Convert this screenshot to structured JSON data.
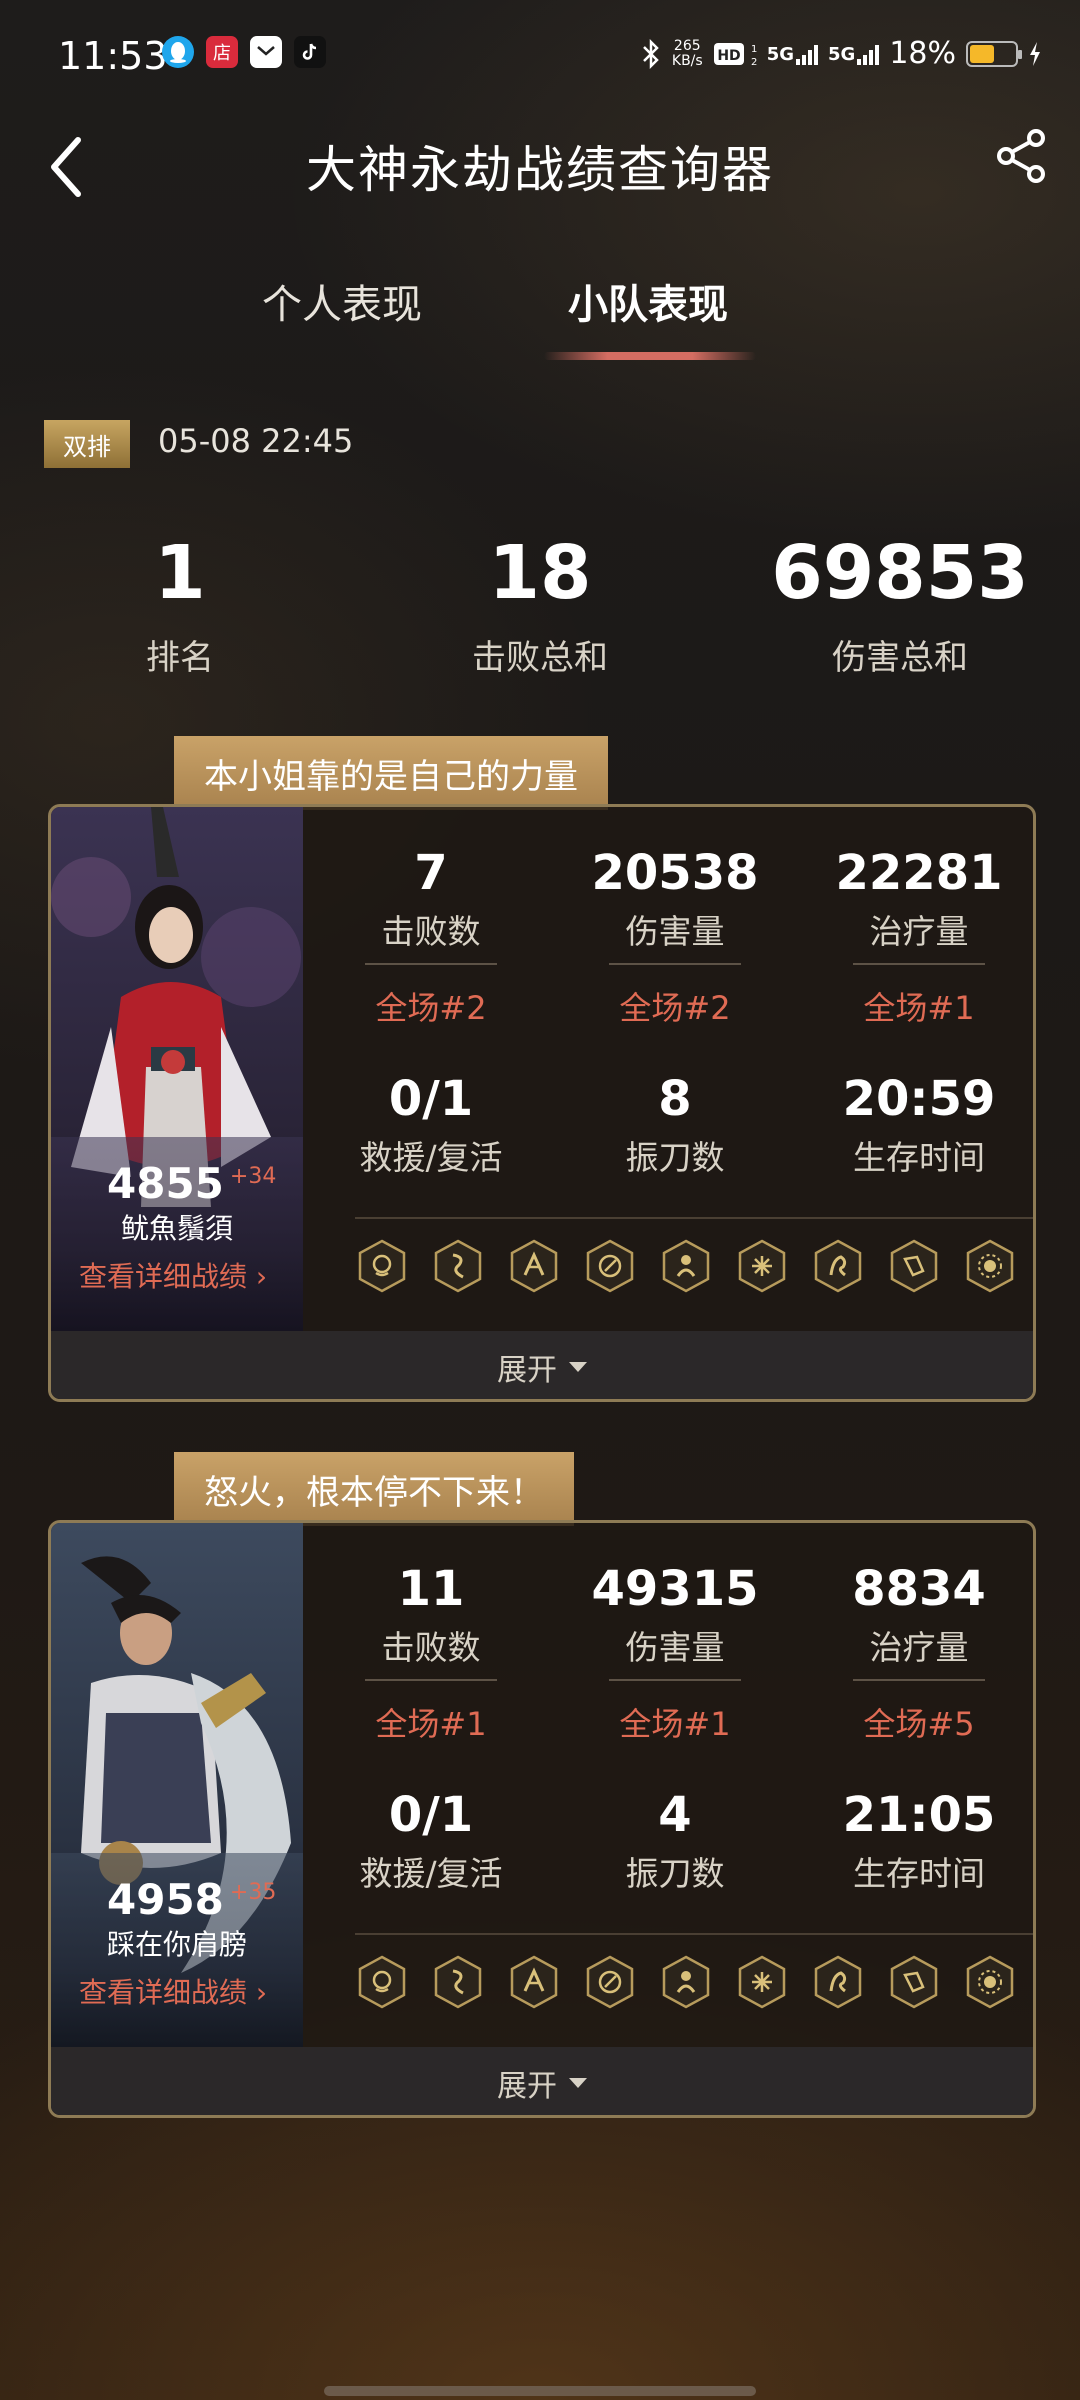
{
  "status_bar": {
    "time": "11:53",
    "net_speed_value": "265",
    "net_speed_unit": "KB/s",
    "network1": "5G",
    "network2": "5G",
    "battery_text": "18%"
  },
  "header": {
    "title": "大神永劫战绩查询器"
  },
  "tabs": {
    "personal": "个人表现",
    "squad": "小队表现"
  },
  "match": {
    "mode": "双排",
    "time": "05-08 22:45"
  },
  "summary": [
    {
      "value": "1",
      "label": "排名"
    },
    {
      "value": "18",
      "label": "击败总和"
    },
    {
      "value": "69853",
      "label": "伤害总和"
    }
  ],
  "players": [
    {
      "quote": "本小姐靠的是自己的力量",
      "score": "4855",
      "score_delta": "+34",
      "name": "鱿魚鬚須",
      "detail_link": "查看详细战绩 ›",
      "stats": [
        {
          "value": "7",
          "label": "击败数",
          "rank": "全场#2"
        },
        {
          "value": "20538",
          "label": "伤害量",
          "rank": "全场#2"
        },
        {
          "value": "22281",
          "label": "治疗量",
          "rank": "全场#1"
        },
        {
          "value": "0/1",
          "label": "救援/复活"
        },
        {
          "value": "8",
          "label": "振刀数"
        },
        {
          "value": "20:59",
          "label": "生存时间"
        }
      ],
      "expand_label": "展开"
    },
    {
      "quote": "怒火，根本停不下来！",
      "score": "4958",
      "score_delta": "+35",
      "name": "踩在你肩膀",
      "detail_link": "查看详细战绩 ›",
      "stats": [
        {
          "value": "11",
          "label": "击败数",
          "rank": "全场#1"
        },
        {
          "value": "49315",
          "label": "伤害量",
          "rank": "全场#1"
        },
        {
          "value": "8834",
          "label": "治疗量",
          "rank": "全场#5"
        },
        {
          "value": "0/1",
          "label": "救援/复活"
        },
        {
          "value": "4",
          "label": "振刀数"
        },
        {
          "value": "21:05",
          "label": "生存时间"
        }
      ],
      "expand_label": "展开"
    }
  ],
  "colors": {
    "accent_rank": "#e06b54",
    "tag_gold": "#c7a561",
    "card_border": "#8e7b55"
  }
}
